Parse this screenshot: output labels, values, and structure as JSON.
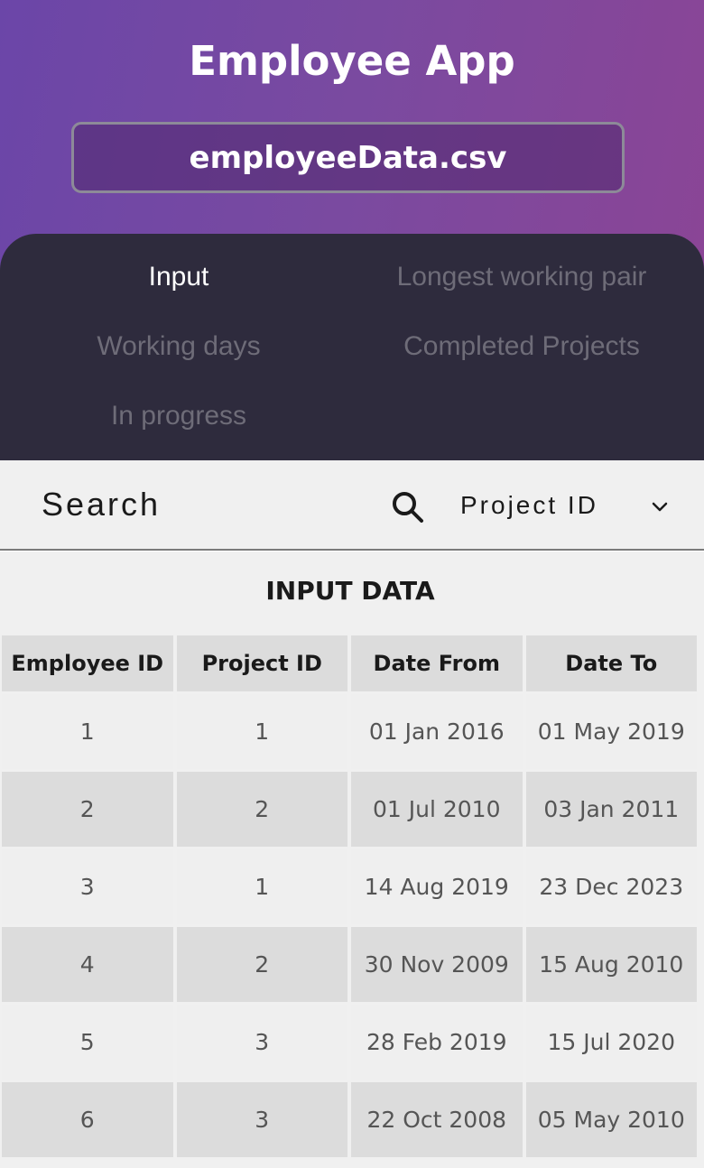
{
  "app": {
    "title": "Employee App",
    "file_name": "employeeData.csv"
  },
  "tabs": [
    {
      "label": "Input",
      "active": true
    },
    {
      "label": "Longest working pair",
      "active": false
    },
    {
      "label": "Working days",
      "active": false
    },
    {
      "label": "Completed Projects",
      "active": false
    },
    {
      "label": "In progress",
      "active": false
    }
  ],
  "search": {
    "placeholder": "Search",
    "icon": "search-icon",
    "filter_selected": "Project ID",
    "filter_icon": "chevron-down-icon"
  },
  "table": {
    "title": "INPUT DATA",
    "columns": [
      "Employee ID",
      "Project ID",
      "Date From",
      "Date To"
    ],
    "rows": [
      [
        "1",
        "1",
        "01 Jan 2016",
        "01 May 2019"
      ],
      [
        "2",
        "2",
        "01 Jul 2010",
        "03 Jan 2011"
      ],
      [
        "3",
        "1",
        "14 Aug 2019",
        "23 Dec 2023"
      ],
      [
        "4",
        "2",
        "30 Nov 2009",
        "15 Aug 2010"
      ],
      [
        "5",
        "3",
        "28 Feb 2019",
        "15 Jul 2020"
      ],
      [
        "6",
        "3",
        "22 Oct 2008",
        "05 May 2010"
      ]
    ]
  },
  "colors": {
    "header_gradient_start": "#6b46a8",
    "header_gradient_end": "#8a4596",
    "tabs_background": "#2e2b3d",
    "active_tab_text": "#ffffff",
    "inactive_tab_text": "#6e6c78"
  }
}
